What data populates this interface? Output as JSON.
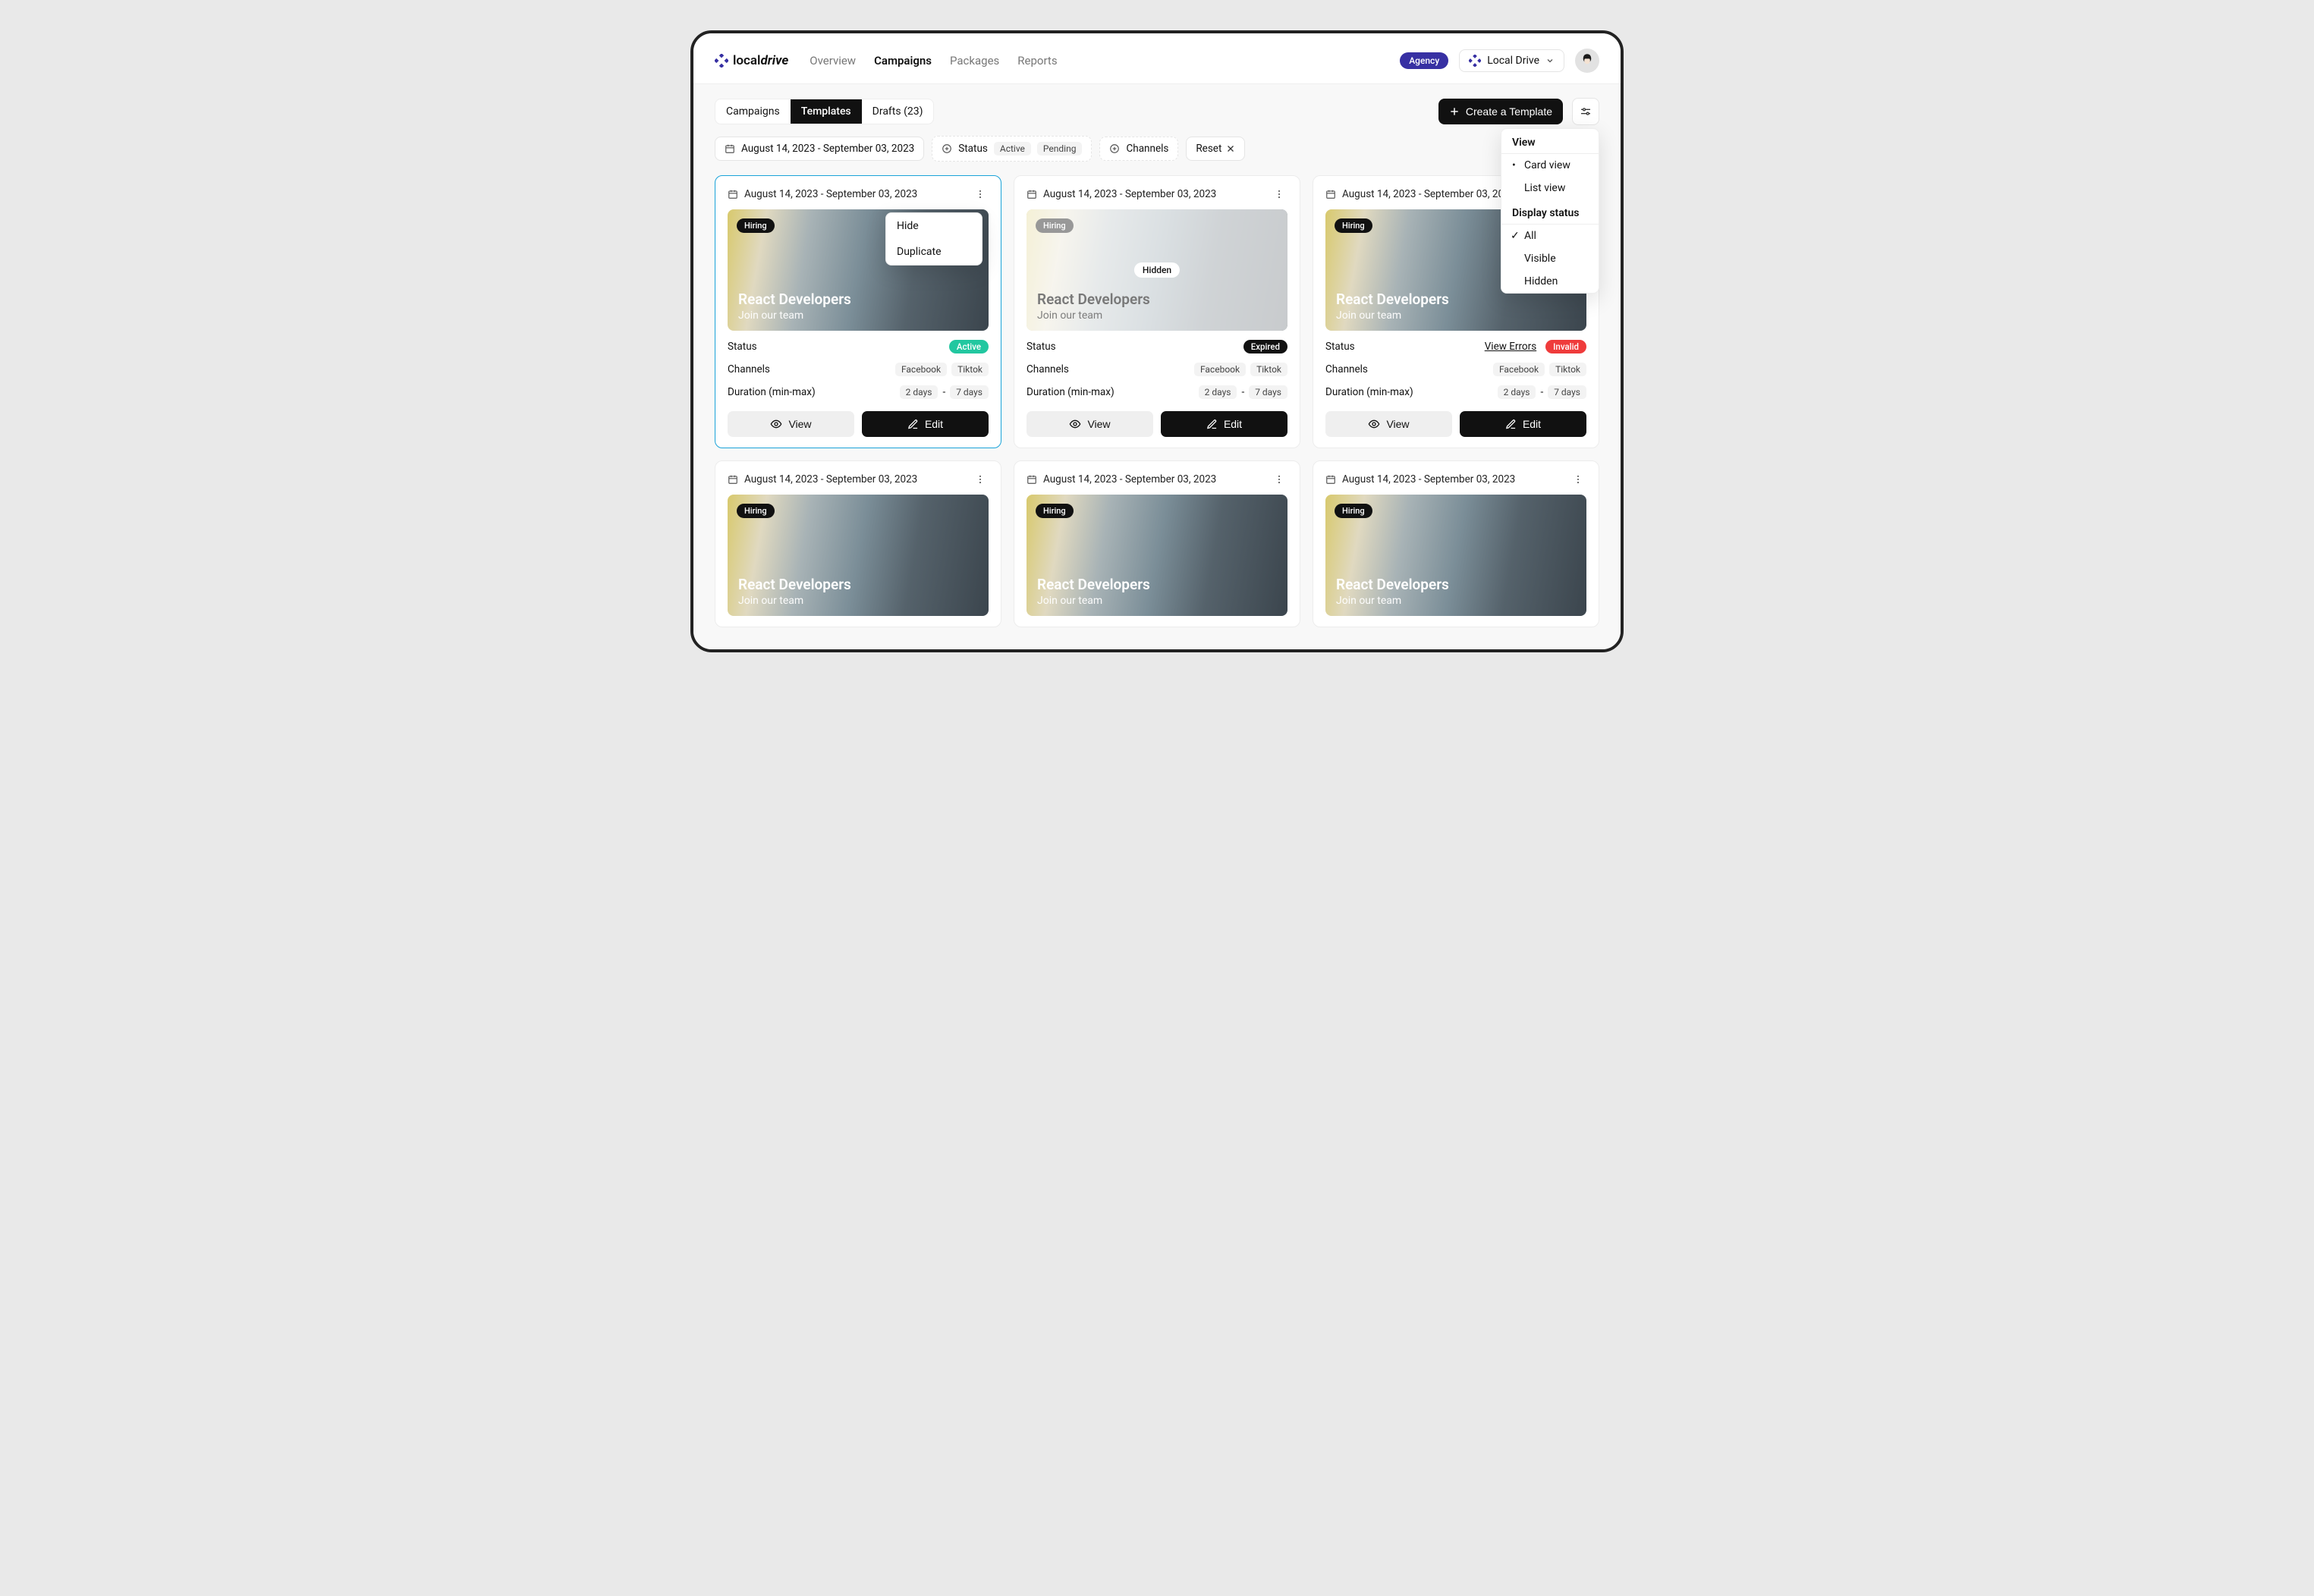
{
  "brand": {
    "name_a": "local",
    "name_b": "drive"
  },
  "nav": {
    "overview": "Overview",
    "campaigns": "Campaigns",
    "packages": "Packages",
    "reports": "Reports",
    "active": "Campaigns"
  },
  "header": {
    "agency_badge": "Agency",
    "workspace": "Local Drive"
  },
  "tabs": {
    "campaigns": "Campaigns",
    "templates": "Templates",
    "drafts": "Drafts (23)"
  },
  "create_button": "Create a Template",
  "filters": {
    "date_range": "August 14, 2023 - September 03, 2023",
    "status_label": "Status",
    "status_values": [
      "Active",
      "Pending"
    ],
    "channels_label": "Channels",
    "reset": "Reset"
  },
  "card_menu": {
    "hide": "Hide",
    "duplicate": "Duplicate"
  },
  "settings_popover": {
    "view_title": "View",
    "card_view": "Card view",
    "list_view": "List view",
    "display_title": "Display status",
    "all": "All",
    "visible": "Visible",
    "hidden": "Hidden"
  },
  "common": {
    "status_label": "Status",
    "channels_label": "Channels",
    "duration_label": "Duration (min-max)",
    "view": "View",
    "edit": "Edit",
    "dash": "-"
  },
  "cards": [
    {
      "date": "August 14, 2023 - September 03, 2023",
      "tag": "Hiring",
      "title": "React Developers",
      "subtitle": "Join our team",
      "status": {
        "kind": "active",
        "label": "Active"
      },
      "channels": [
        "Facebook",
        "Tiktok"
      ],
      "duration": [
        "2 days",
        "7 days"
      ],
      "selected": true,
      "faded": false,
      "hidden_pill": null,
      "errors_link": null,
      "menu_open": true
    },
    {
      "date": "August 14, 2023 - September 03, 2023",
      "tag": "Hiring",
      "title": "React Developers",
      "subtitle": "Join our team",
      "status": {
        "kind": "expired",
        "label": "Expired"
      },
      "channels": [
        "Facebook",
        "Tiktok"
      ],
      "duration": [
        "2 days",
        "7 days"
      ],
      "selected": false,
      "faded": true,
      "hidden_pill": "Hidden",
      "errors_link": null,
      "menu_open": false
    },
    {
      "date": "August 14, 2023 - September 03, 2023",
      "tag": "Hiring",
      "title": "React Developers",
      "subtitle": "Join our team",
      "status": {
        "kind": "invalid",
        "label": "Invalid"
      },
      "channels": [
        "Facebook",
        "Tiktok"
      ],
      "duration": [
        "2 days",
        "7 days"
      ],
      "selected": false,
      "faded": false,
      "hidden_pill": null,
      "errors_link": "View Errors",
      "menu_open": false
    },
    {
      "date": "August 14, 2023 - September 03, 2023",
      "tag": "Hiring",
      "title": "React Developers",
      "subtitle": "Join our team",
      "status": null,
      "channels": [],
      "duration": [],
      "selected": false,
      "faded": false,
      "hidden_pill": null,
      "errors_link": null,
      "menu_open": false
    },
    {
      "date": "August 14, 2023 - September 03, 2023",
      "tag": "Hiring",
      "title": "React Developers",
      "subtitle": "Join our team",
      "status": null,
      "channels": [],
      "duration": [],
      "selected": false,
      "faded": false,
      "hidden_pill": null,
      "errors_link": null,
      "menu_open": false
    },
    {
      "date": "August 14, 2023 - September 03, 2023",
      "tag": "Hiring",
      "title": "React Developers",
      "subtitle": "Join our team",
      "status": null,
      "channels": [],
      "duration": [],
      "selected": false,
      "faded": false,
      "hidden_pill": null,
      "errors_link": null,
      "menu_open": false
    }
  ]
}
